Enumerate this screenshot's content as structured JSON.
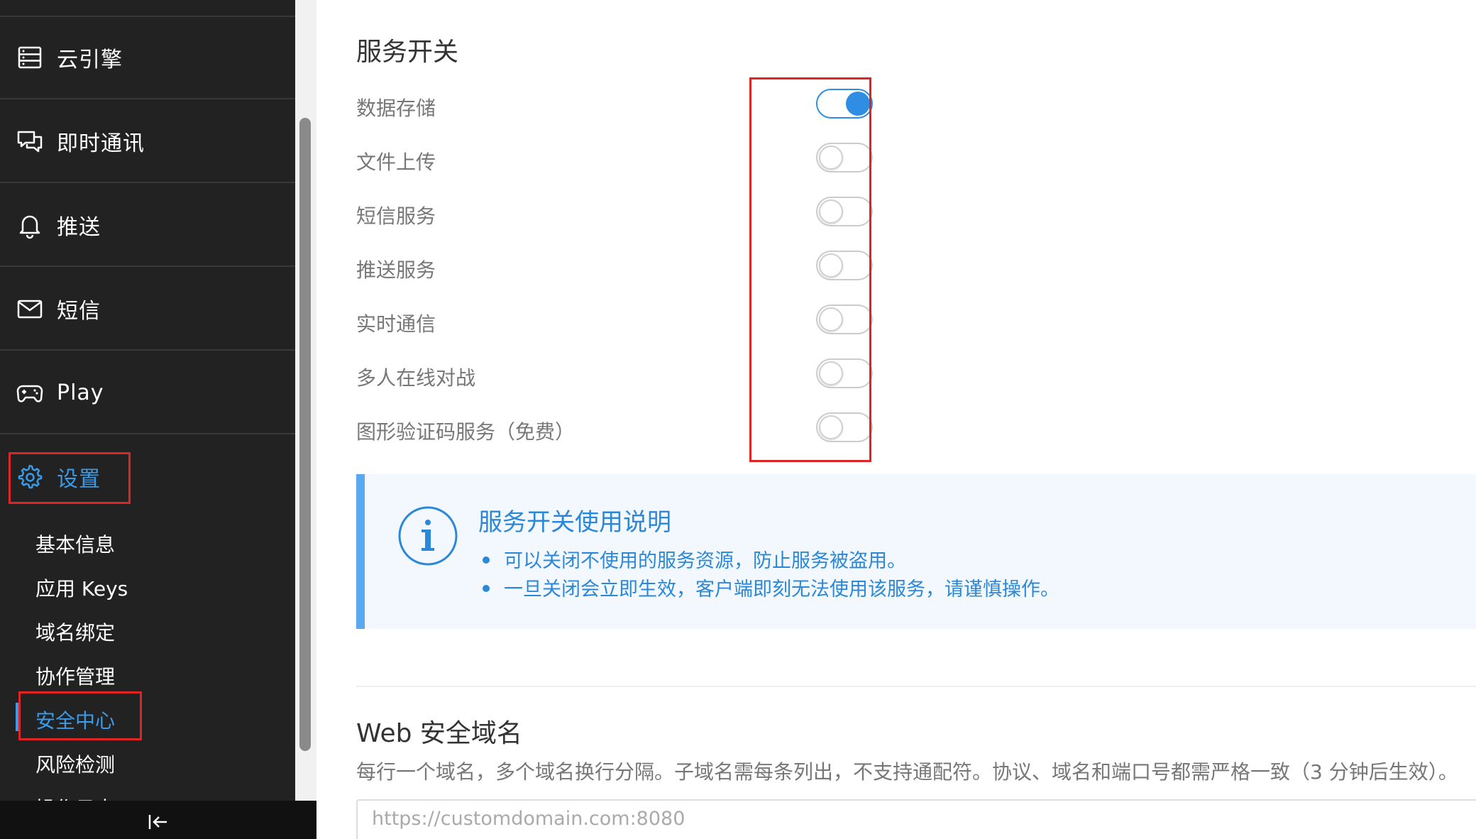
{
  "sidebar": {
    "nav": [
      {
        "label": "云引擎",
        "icon": "server-icon"
      },
      {
        "label": "即时通讯",
        "icon": "chat-icon"
      },
      {
        "label": "推送",
        "icon": "bell-icon"
      },
      {
        "label": "短信",
        "icon": "mail-icon"
      },
      {
        "label": "Play",
        "icon": "gamepad-icon"
      },
      {
        "label": "设置",
        "icon": "gear-icon"
      }
    ],
    "sub_items": [
      "基本信息",
      "应用 Keys",
      "域名绑定",
      "协作管理",
      "安全中心",
      "风险检测",
      "操作日志"
    ],
    "active_sub": "安全中心",
    "collapse_icon": "collapse-left-icon"
  },
  "main": {
    "services": {
      "title": "服务开关",
      "toggles": [
        {
          "label": "数据存储",
          "on": true
        },
        {
          "label": "文件上传",
          "on": false
        },
        {
          "label": "短信服务",
          "on": false
        },
        {
          "label": "推送服务",
          "on": false
        },
        {
          "label": "实时通信",
          "on": false
        },
        {
          "label": "多人在线对战",
          "on": false
        },
        {
          "label": "图形验证码服务（免费）",
          "on": false
        }
      ]
    },
    "info": {
      "icon": "info-icon",
      "title": "服务开关使用说明",
      "bullets": [
        "可以关闭不使用的服务资源，防止服务被盗用。",
        "一旦关闭会立即生效，客户端即刻无法使用该服务，请谨慎操作。"
      ]
    },
    "web_security": {
      "title": "Web 安全域名",
      "description": "每行一个域名，多个域名换行分隔。子域名需每条列出，不支持通配符。协议、域名和端口号都需严格一致（3 分钟后生效）。",
      "placeholder": "https://customdomain.com:8080"
    }
  },
  "colors": {
    "accent": "#3a9be8",
    "highlight": "#e02424",
    "sidebar_bg": "#222222"
  }
}
